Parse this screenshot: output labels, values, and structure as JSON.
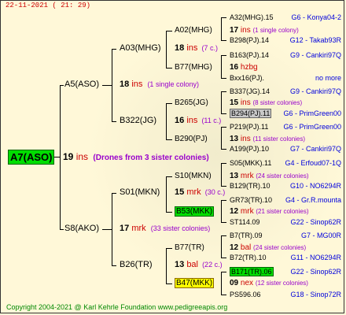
{
  "header": {
    "date": "22-11-2021 ( 21: 29)"
  },
  "footer": {
    "text": "Copyright 2004-2021 @ Karl Kehrle Foundation    www.pedigreeapis.org"
  },
  "root": {
    "id": "A7(ASO)",
    "count": "19",
    "unit": "ins",
    "note": "(Drones from 3 sister colonies)"
  },
  "gen1": [
    {
      "id": "A5(ASO)",
      "count": "18",
      "unit": "ins",
      "note": "(1 single colony)"
    },
    {
      "id": "S8(AKO)",
      "count": "17",
      "unit": "mrk",
      "note": "(33 sister colonies)"
    }
  ],
  "gen2": [
    {
      "id": "A03(MHG)",
      "count": "18",
      "unit": "ins",
      "note": "(7 c.)"
    },
    {
      "id": "B322(JG)",
      "count": "16",
      "unit": "ins",
      "note": "(11 c.)"
    },
    {
      "id": "S01(MKN)",
      "count": "15",
      "unit": "mrk",
      "note": "(30 c.)"
    },
    {
      "id": "B26(TR)",
      "count": "13",
      "unit": "bal",
      "note": "(22 c.)"
    }
  ],
  "gen3": [
    {
      "id": "A02(MHG)",
      "count": "17",
      "unit": "ins",
      "note": "(1 single colony)"
    },
    {
      "id": "B77(MHG)",
      "count": "",
      "unit": "",
      "note": ""
    },
    {
      "id": "B265(JG)",
      "count": "15",
      "unit": "ins",
      "note": "(8 sister colonies)"
    },
    {
      "id": "B290(PJ)",
      "count": "",
      "unit": "",
      "note": ""
    },
    {
      "id": "S10(MKN)",
      "count": "13",
      "unit": "mrk",
      "note": "(24 sister colonies)"
    },
    {
      "id": "B53(MKK)",
      "count": "",
      "unit": "",
      "note": ""
    },
    {
      "id": "B77(TR)",
      "count": "12",
      "unit": "bal",
      "note": "(24 sister colonies)"
    },
    {
      "id": "B47(MKK)",
      "count": "",
      "unit": "",
      "note": ""
    }
  ],
  "gen3_second": [
    {
      "count": "16",
      "unit": "hzbg",
      "note": ""
    },
    {
      "count": "13",
      "unit": "ins",
      "note": "(11 sister colonies)"
    },
    {
      "count": "12",
      "unit": "mrk",
      "note": "(21 sister colonies)"
    },
    {
      "count": "09",
      "unit": "nex",
      "note": "(12 sister colonies)"
    }
  ],
  "gen4": [
    {
      "id": "A32(MHG).15",
      "group": "G6 - Konya04-2"
    },
    {
      "id": "B298(PJ).14",
      "group": "G12 - Takab93R"
    },
    {
      "id": "B163(PJ).14",
      "group": "G9 - Cankiri97Q"
    },
    {
      "id": "Bxx16(PJ).",
      "group": "no more"
    },
    {
      "id": "B337(JG).14",
      "group": "G9 - Cankiri97Q"
    },
    {
      "id": "B294(PJ).11",
      "group": "G6 - PrimGreen00"
    },
    {
      "id": "P219(PJ).11",
      "group": "G6 - PrimGreen00"
    },
    {
      "id": "A199(PJ).10",
      "group": "G7 - Cankiri97Q"
    },
    {
      "id": "S05(MKK).11",
      "group": "G4 - Erfoud07-1Q"
    },
    {
      "id": "B129(TR).10",
      "group": "G10 - NO6294R"
    },
    {
      "id": "GR73(TR).10",
      "group": "G4 - Gr.R.mounta"
    },
    {
      "id": "ST114.09",
      "group": "G22 - Sinop62R"
    },
    {
      "id": "B7(TR).09",
      "group": "G7 - MG00R"
    },
    {
      "id": "B72(TR).10",
      "group": "G11 - NO6294R"
    },
    {
      "id": "B171(TR).06",
      "group": "G22 - Sinop62R"
    },
    {
      "id": "PS596.06",
      "group": "G18 - Sinop72R"
    }
  ]
}
